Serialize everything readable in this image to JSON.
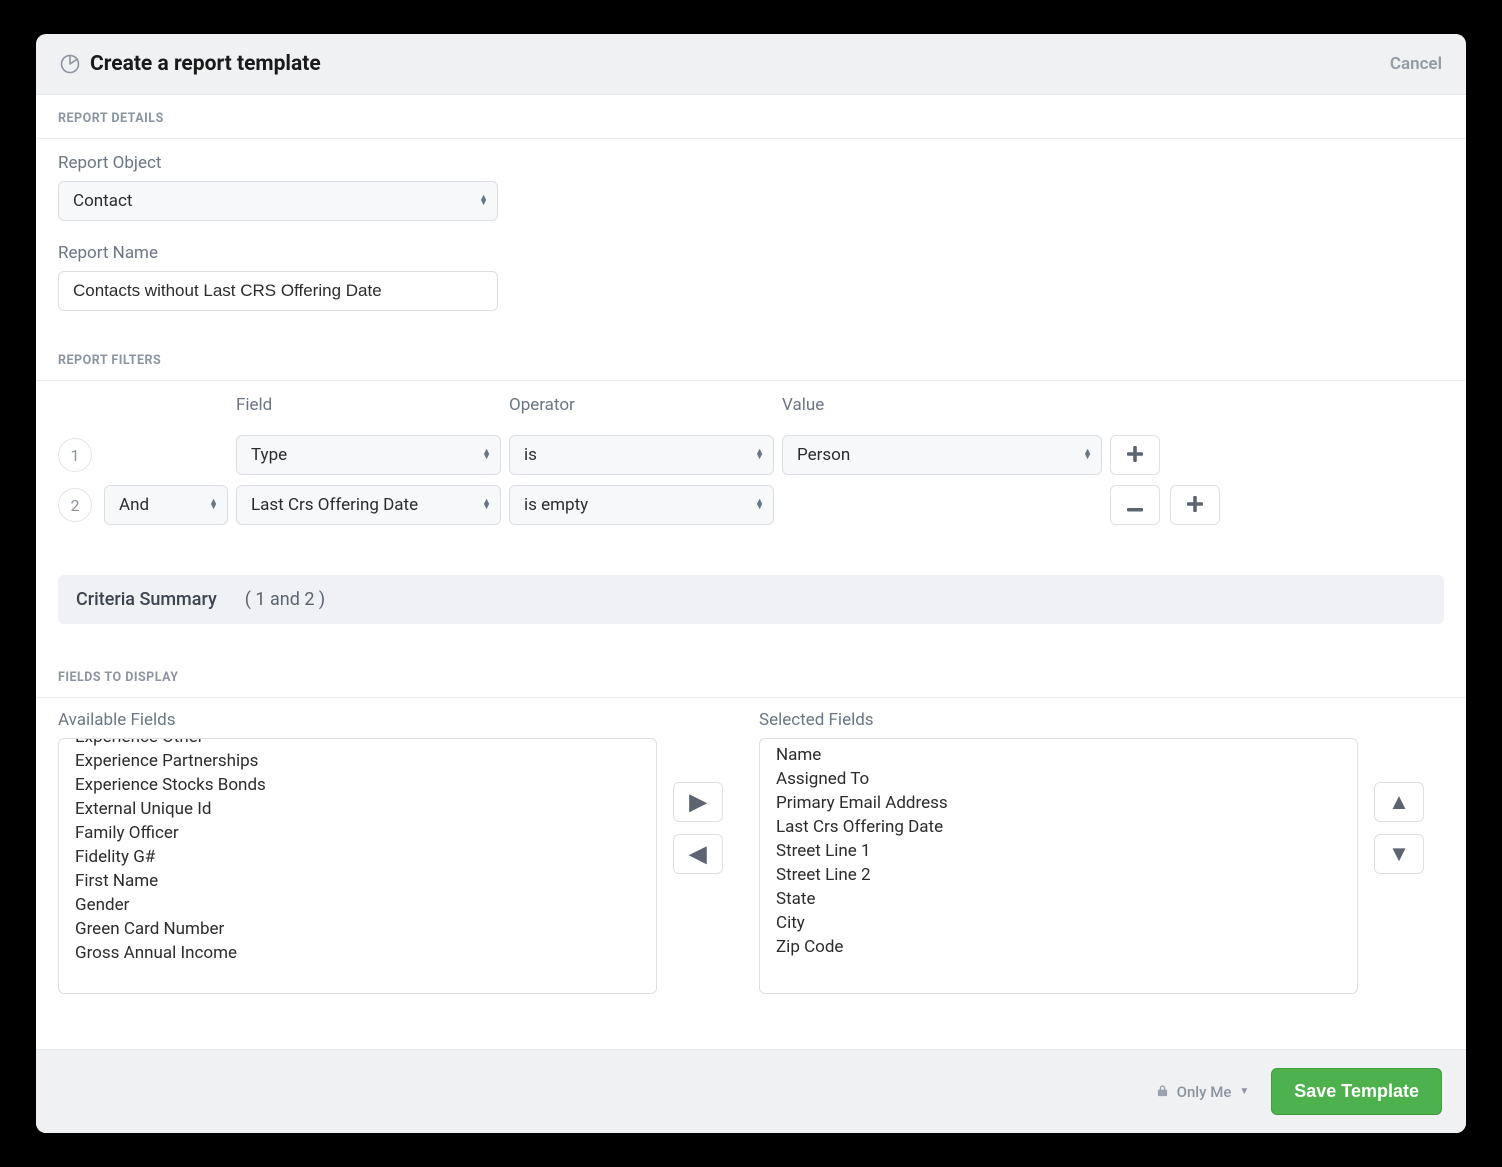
{
  "header": {
    "title": "Create a report template",
    "cancel_label": "Cancel"
  },
  "sections": {
    "details_hdr": "REPORT DETAILS",
    "filters_hdr": "REPORT FILTERS",
    "fields_hdr": "FIELDS TO DISPLAY"
  },
  "details": {
    "report_object_label": "Report Object",
    "report_object_value": "Contact",
    "report_name_label": "Report Name",
    "report_name_value": "Contacts without Last CRS Offering Date"
  },
  "filters": {
    "col_field": "Field",
    "col_operator": "Operator",
    "col_value": "Value",
    "rows": [
      {
        "num": "1",
        "conj": "",
        "field": "Type",
        "operator": "is",
        "value": "Person",
        "show_remove": false,
        "show_value": true
      },
      {
        "num": "2",
        "conj": "And",
        "field": "Last Crs Offering Date",
        "operator": "is empty",
        "value": "",
        "show_remove": true,
        "show_value": false
      }
    ],
    "criteria_label": "Criteria Summary",
    "criteria_expr": "( 1 and 2 )"
  },
  "fields": {
    "available_label": "Available Fields",
    "selected_label": "Selected Fields",
    "available": [
      "Experience Other",
      "Experience Partnerships",
      "Experience Stocks Bonds",
      "External Unique Id",
      "Family Officer",
      "Fidelity G#",
      "First Name",
      "Gender",
      "Green Card Number",
      "Gross Annual Income"
    ],
    "selected": [
      "Name",
      "Assigned To",
      "Primary Email Address",
      "Last Crs Offering Date",
      "Street Line 1",
      "Street Line 2",
      "State",
      "City",
      "Zip Code"
    ]
  },
  "footer": {
    "privacy": "Only Me",
    "save_label": "Save Template"
  }
}
